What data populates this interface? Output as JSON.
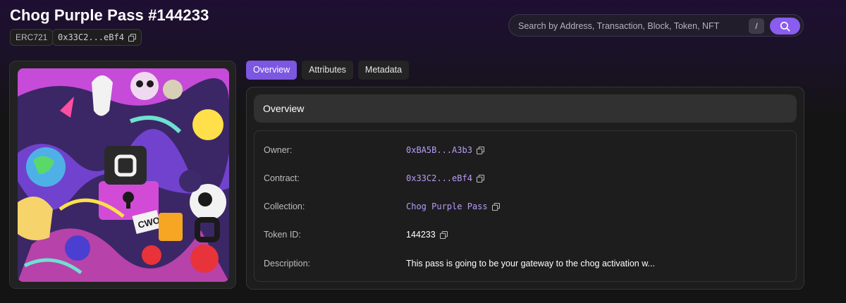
{
  "title": "Chog Purple Pass #144233",
  "chips": {
    "standard": "ERC721",
    "contract_short": "0x33C2...eBf4"
  },
  "search": {
    "placeholder": "Search by Address, Transaction, Block, Token, NFT",
    "shortcut": "/"
  },
  "tabs": [
    "Overview",
    "Attributes",
    "Metadata"
  ],
  "active_tab": "Overview",
  "panel": {
    "header": "Overview",
    "rows": [
      {
        "label": "Owner:",
        "value": "0xBA5B...A3b3"
      },
      {
        "label": "Contract:",
        "value": "0x33C2...eBf4"
      },
      {
        "label": "Collection:",
        "value": "Chog Purple Pass"
      },
      {
        "label": "Token ID:",
        "value": "144233"
      },
      {
        "label": "Description:",
        "value": "This pass is going to be your gateway to the chog activation w..."
      }
    ]
  },
  "art_label": "CWO",
  "colors": {
    "accent": "#7c57e0",
    "link": "#b79cf7",
    "background": "#141414"
  }
}
